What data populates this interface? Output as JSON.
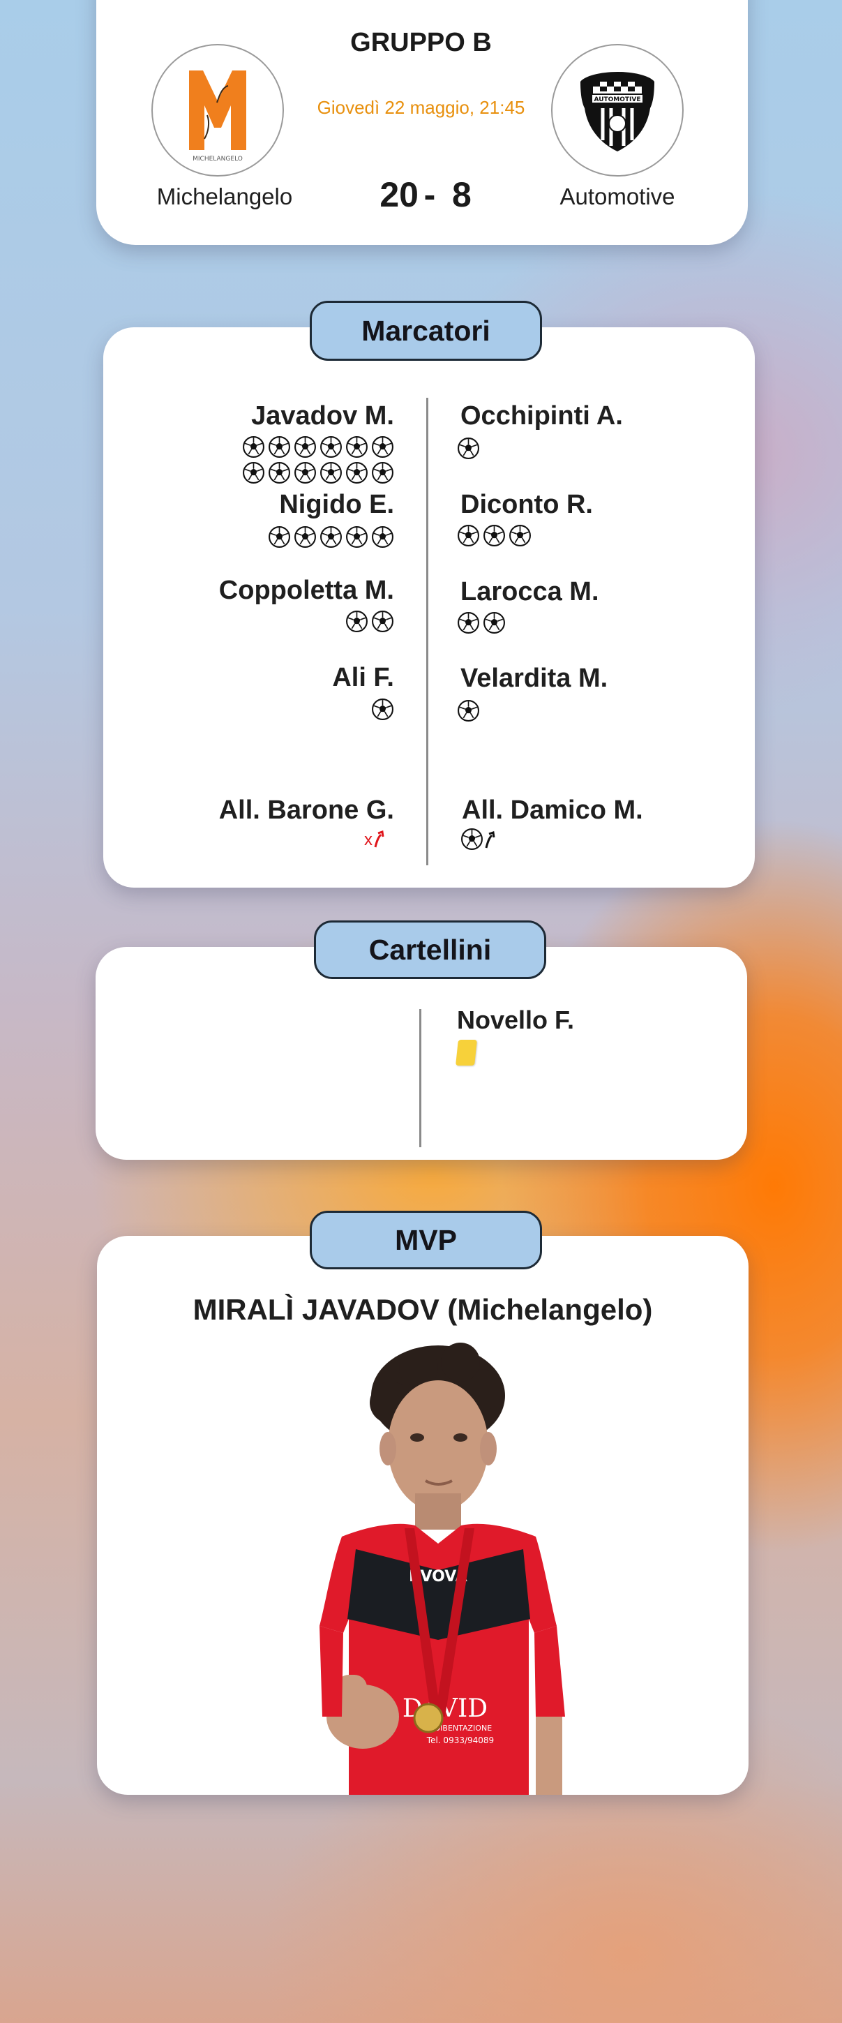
{
  "header": {
    "group": "GRUPPO B",
    "datetime": "Giovedì 22 maggio, 21:45",
    "home_team": "Michelangelo",
    "away_team": "Automotive",
    "home_score": "20",
    "separator": "-",
    "away_score": "8",
    "home_logo_text": "MICHELANGELO",
    "away_logo_text": "AUTOMOTIVE"
  },
  "scorers": {
    "title": "Marcatori",
    "home": [
      {
        "name": "Javadov M.",
        "goals": 12
      },
      {
        "name": "Nigido E.",
        "goals": 5
      },
      {
        "name": "Coppoletta M.",
        "goals": 2
      },
      {
        "name": "Ali F.",
        "goals": 1
      }
    ],
    "away": [
      {
        "name": "Occhipinti A.",
        "goals": 1
      },
      {
        "name": "Diconto R.",
        "goals": 3
      },
      {
        "name": "Larocca M.",
        "goals": 2
      },
      {
        "name": "Velardita M.",
        "goals": 1
      }
    ],
    "home_coach": "All. Barone G.",
    "away_coach": "All. Damico M.",
    "home_coach_mark": "x"
  },
  "cards": {
    "title": "Cartellini",
    "away": [
      {
        "name": "Novello F.",
        "card": "yellow"
      }
    ]
  },
  "mvp": {
    "title": "MVP",
    "player": "MIRALÌ JAVADOV (Michelangelo)",
    "shirt_brand": "IIVOVA",
    "shirt_sponsor": "DAVID",
    "shirt_sponsor_sub": "COIBENTAZIONE",
    "shirt_phone": "Tel. 0933/94089"
  },
  "colors": {
    "accent_orange": "#e8900e",
    "pill_blue": "#a9cbea",
    "yellow_card": "#f7d13a",
    "coach_red": "#e0151b",
    "shirt_red": "#e01a2a"
  }
}
